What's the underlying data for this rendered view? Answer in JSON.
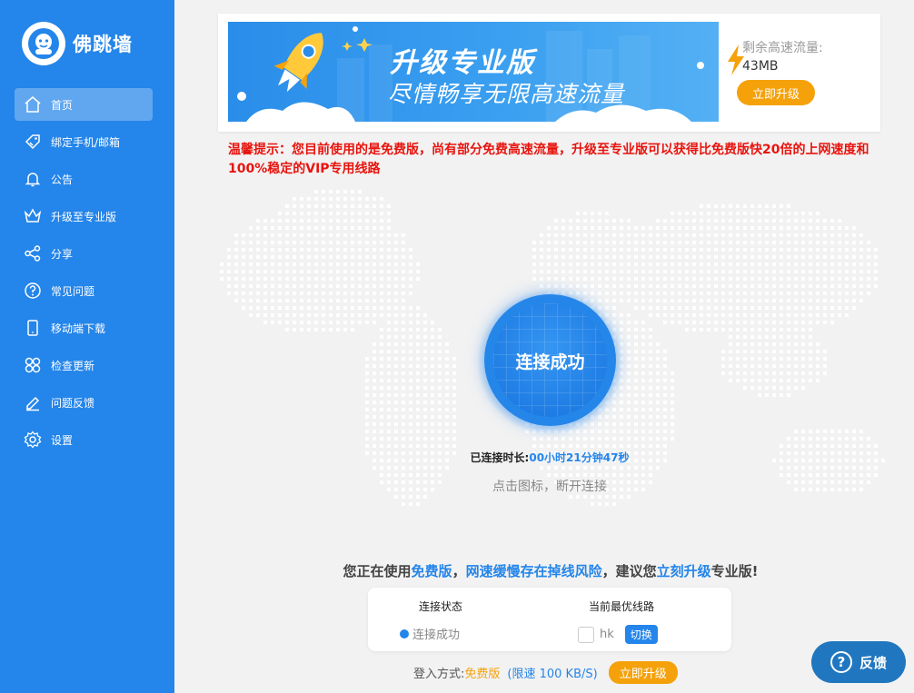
{
  "app": {
    "name": "佛跳墙"
  },
  "sidebar": {
    "items": [
      {
        "label": "首页",
        "icon": "home-icon"
      },
      {
        "label": "绑定手机/邮箱",
        "icon": "tag-icon"
      },
      {
        "label": "公告",
        "icon": "bell-icon"
      },
      {
        "label": "升级至专业版",
        "icon": "crown-icon"
      },
      {
        "label": "分享",
        "icon": "share-icon"
      },
      {
        "label": "常见问题",
        "icon": "question-icon"
      },
      {
        "label": "移动端下载",
        "icon": "phone-icon"
      },
      {
        "label": "检查更新",
        "icon": "grid-icon"
      },
      {
        "label": "问题反馈",
        "icon": "pencil-icon"
      },
      {
        "label": "设置",
        "icon": "gear-icon"
      }
    ]
  },
  "banner": {
    "title": "升级专业版",
    "subtitle": "尽情畅享无限高速流量",
    "remain_label": "剩余高速流量:",
    "remain_value": "43MB",
    "upgrade_label": "立即升级"
  },
  "tip": "温馨提示：您目前使用的是免费版，尚有部分免费高速流量，升级至专业版可以获得比免费版快20倍的上网速度和100%稳定的VIP专用线路",
  "connect": {
    "label": "连接成功",
    "duration_label": "已连接时长:",
    "duration_value": "00小时21分钟47秒",
    "hint": "点击图标，断开连接"
  },
  "notice": {
    "p1": "您正在使用",
    "free": "免费版",
    "p2": "，",
    "risk": "网速缓慢存在掉线风险",
    "p3": "，建议您",
    "upgrade": "立刻升级",
    "p4": "专业版!"
  },
  "status": {
    "state_header": "连接状态",
    "state_value": "连接成功",
    "line_header": "当前最优线路",
    "line_value": "hk",
    "switch_label": "切换"
  },
  "login": {
    "label": "登入方式:",
    "mode": "免费版",
    "limit": "(限速 100 KB/S)",
    "upgrade_label": "立即升级"
  },
  "feedback": {
    "label": "反馈"
  },
  "colors": {
    "primary": "#2485ea",
    "accent": "#f5a10a",
    "warning": "#e8140e"
  }
}
